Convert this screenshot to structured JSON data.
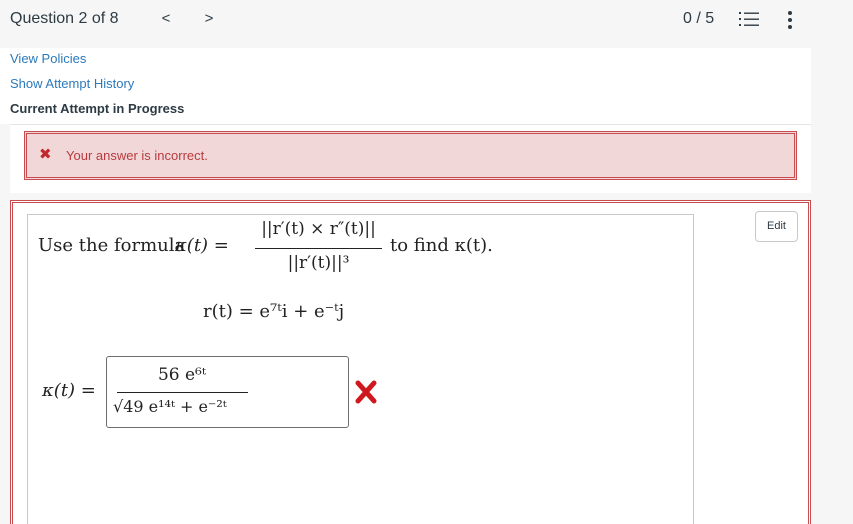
{
  "header": {
    "question_label": "Question 2 of 8",
    "prev_glyph": "<",
    "next_glyph": ">",
    "score": "0 / 5"
  },
  "links": {
    "view_policies": "View Policies",
    "show_history": "Show Attempt History",
    "current_attempt": "Current Attempt in Progress"
  },
  "feedback": {
    "icon": "x-icon",
    "message": "Your answer is incorrect.",
    "color": "#c84d50"
  },
  "question": {
    "edit_label": "Edit",
    "intro_prefix": "Use the formula ",
    "kappa_def": "κ(t) =",
    "formula_numerator": "||r′(t) × r″(t)||",
    "formula_denominator": "||r′(t)||³",
    "intro_suffix": "to find κ(t).",
    "r_definition": "r(t) = e⁷ᵗi + e⁻ᵗj",
    "answer_label": "κ(t) =",
    "answer_numerator": "56 e⁶ᵗ",
    "answer_denominator": "√49 e¹⁴ᵗ + e⁻²ᵗ",
    "result_icon": "wrong-x-icon"
  },
  "colors": {
    "link": "#2b7abc",
    "error_text": "#b73b3e",
    "error_bg": "#f2d7d8",
    "wrong_mark": "#d0171d"
  }
}
